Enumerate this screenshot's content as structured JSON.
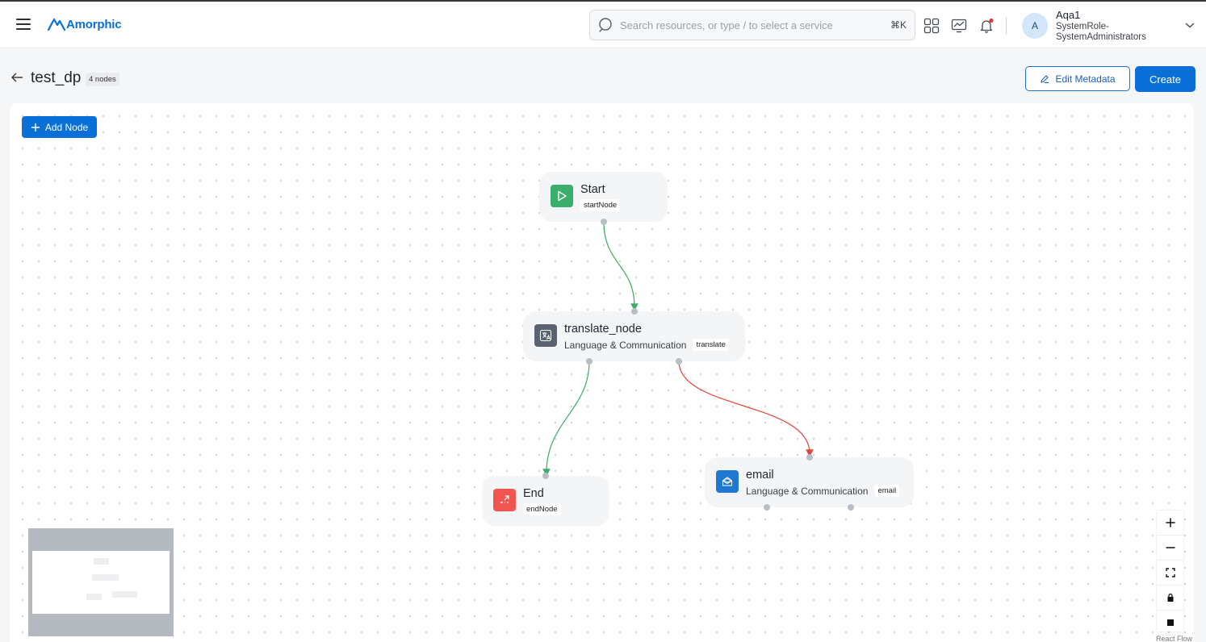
{
  "app": {
    "brand": "Amorphic",
    "brand_color": "#0a6fd6"
  },
  "header": {
    "menu_icon": "hamburger-icon",
    "search": {
      "placeholder": "Search resources, or type / to select a service",
      "value": "",
      "shortcut": "⌘K"
    },
    "icons": [
      "apps-grid-icon",
      "monitor-chart-icon",
      "bell-icon"
    ],
    "user": {
      "initial": "A",
      "name": "Aqa1",
      "role_line1": "SystemRole-",
      "role_line2": "SystemAdministrators"
    }
  },
  "page": {
    "title": "test_dp",
    "node_count": "4 nodes",
    "edit_metadata_label": "Edit Metadata",
    "create_label": "Create"
  },
  "canvas": {
    "add_node_label": "Add Node",
    "nodes": {
      "start": {
        "title": "Start",
        "tag": "startNode",
        "color": "#3aae6a"
      },
      "translate": {
        "title": "translate_node",
        "category": "Language & Communication",
        "tag": "translate",
        "color": "#5a6272"
      },
      "end": {
        "title": "End",
        "tag": "endNode",
        "color": "#f0564f"
      },
      "email": {
        "title": "email",
        "category": "Language & Communication",
        "tag": "email",
        "color": "#1f78d1"
      }
    },
    "edge_colors": {
      "success": "#3aae6a",
      "failure": "#e0463c"
    },
    "attribution": "React Flow"
  }
}
